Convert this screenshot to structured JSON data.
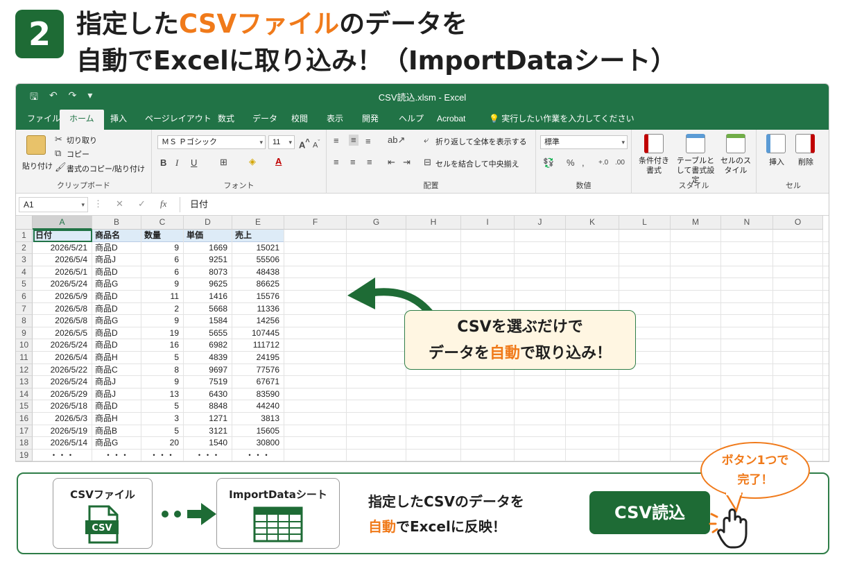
{
  "header": {
    "step_number": "2",
    "line1_part1": "指定した",
    "line1_highlight": "CSVファイル",
    "line1_part2": "のデータを",
    "line2": "自動でExcelに取り込み！（ImportDataシート）"
  },
  "excel": {
    "window_title": "CSV読込.xlsm  -  Excel",
    "tabs": [
      "ファイル",
      "ホーム",
      "挿入",
      "ページレイアウト",
      "数式",
      "データ",
      "校閲",
      "表示",
      "開発",
      "ヘルプ",
      "Acrobat"
    ],
    "tell_me": "実行したい作業を入力してください",
    "ribbon": {
      "clipboard": {
        "paste": "貼り付け",
        "cut": "切り取り",
        "copy": "コピー",
        "format_painter": "書式のコピー/貼り付け",
        "label": "クリップボード"
      },
      "font": {
        "font_name": "ＭＳ Ｐゴシック",
        "font_size": "11",
        "bold": "B",
        "italic": "I",
        "underline": "U",
        "label": "フォント"
      },
      "alignment": {
        "wrap": "折り返して全体を表示する",
        "merge": "セルを結合して中央揃え",
        "label": "配置"
      },
      "number": {
        "format": "標準",
        "label": "数値"
      },
      "styles": {
        "conditional": "条件付き書式",
        "table": "テーブルとして書式設定",
        "cell_styles": "セルのスタイル",
        "label": "スタイル"
      },
      "cells": {
        "insert": "挿入",
        "delete": "削除",
        "label": "セル"
      }
    },
    "name_box": "A1",
    "formula_value": "日付",
    "columns": [
      "A",
      "B",
      "C",
      "D",
      "E",
      "F",
      "G",
      "H",
      "I",
      "J",
      "K",
      "L",
      "M",
      "N",
      "O"
    ],
    "table_headers": [
      "日付",
      "商品名",
      "数量",
      "単価",
      "売上"
    ],
    "rows": [
      [
        "2026/5/21",
        "商品D",
        "9",
        "1669",
        "15021"
      ],
      [
        "2026/5/4",
        "商品J",
        "6",
        "9251",
        "55506"
      ],
      [
        "2026/5/1",
        "商品D",
        "6",
        "8073",
        "48438"
      ],
      [
        "2026/5/24",
        "商品G",
        "9",
        "9625",
        "86625"
      ],
      [
        "2026/5/9",
        "商品D",
        "11",
        "1416",
        "15576"
      ],
      [
        "2026/5/8",
        "商品D",
        "2",
        "5668",
        "11336"
      ],
      [
        "2026/5/8",
        "商品G",
        "9",
        "1584",
        "14256"
      ],
      [
        "2026/5/5",
        "商品D",
        "19",
        "5655",
        "107445"
      ],
      [
        "2026/5/24",
        "商品D",
        "16",
        "6982",
        "111712"
      ],
      [
        "2026/5/4",
        "商品H",
        "5",
        "4839",
        "24195"
      ],
      [
        "2026/5/22",
        "商品C",
        "8",
        "9697",
        "77576"
      ],
      [
        "2026/5/24",
        "商品J",
        "9",
        "7519",
        "67671"
      ],
      [
        "2026/5/29",
        "商品J",
        "13",
        "6430",
        "83590"
      ],
      [
        "2026/5/18",
        "商品D",
        "5",
        "8848",
        "44240"
      ],
      [
        "2026/5/3",
        "商品H",
        "3",
        "1271",
        "3813"
      ],
      [
        "2026/5/19",
        "商品B",
        "5",
        "3121",
        "15605"
      ],
      [
        "2026/5/14",
        "商品G",
        "20",
        "1540",
        "30800"
      ],
      [
        "・・・",
        "・・・",
        "・・・",
        "・・・",
        "・・・"
      ]
    ]
  },
  "callout": {
    "line1": "CSVを選ぶだけで",
    "line2_part1": "データを",
    "line2_highlight": "自動",
    "line2_part2": "で取り込み！"
  },
  "flow": {
    "card1_title": "CSVファイル",
    "card1_icon_label": "CSV",
    "card2_title": "ImportDataシート",
    "text_line1": "指定したCSVのデータを",
    "text_line2_highlight": "自動",
    "text_line2_rest": "でExcelに反映！",
    "button_label": "CSV読込",
    "bubble_line1": "ボタン1つで",
    "bubble_line2": "完了！"
  },
  "colors": {
    "excel_green": "#217346",
    "badge_green": "#1e6b35",
    "accent_orange": "#f07a1a",
    "callout_bg": "#fff6e2",
    "header_cell_bg": "#ddebf7"
  }
}
